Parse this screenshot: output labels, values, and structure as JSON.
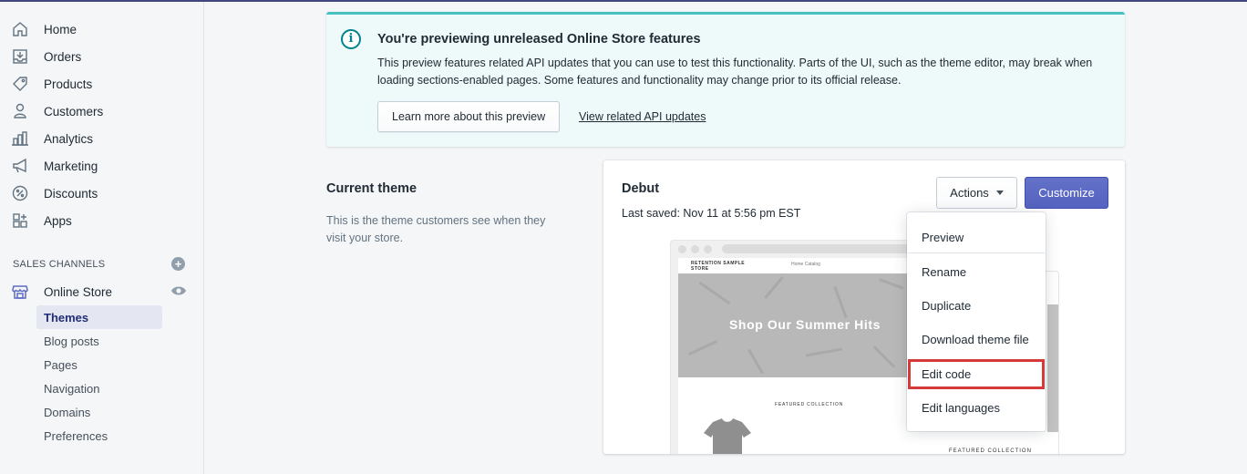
{
  "sidebar": {
    "items": [
      {
        "label": "Home",
        "icon": "home-icon"
      },
      {
        "label": "Orders",
        "icon": "orders-icon"
      },
      {
        "label": "Products",
        "icon": "tag-icon"
      },
      {
        "label": "Customers",
        "icon": "person-icon"
      },
      {
        "label": "Analytics",
        "icon": "bar-chart-icon"
      },
      {
        "label": "Marketing",
        "icon": "megaphone-icon"
      },
      {
        "label": "Discounts",
        "icon": "discount-icon"
      },
      {
        "label": "Apps",
        "icon": "apps-icon"
      }
    ],
    "sales_channels_title": "SALES CHANNELS",
    "online_store_label": "Online Store",
    "sub_items": [
      "Themes",
      "Blog posts",
      "Pages",
      "Navigation",
      "Domains",
      "Preferences"
    ],
    "active_sub_item": "Themes"
  },
  "banner": {
    "title": "You're previewing unreleased Online Store features",
    "body": "This preview features related API updates that you can use to test this functionality. Parts of the UI, such as the theme editor, may break when loading sections-enabled pages. Some features and functionality may change prior to its official release.",
    "button_label": "Learn more about this preview",
    "link_label": "View related API updates",
    "accent_color": "#47c1bf"
  },
  "current_theme": {
    "heading": "Current theme",
    "description": "This is the theme customers see when they visit your store.",
    "theme_name": "Debut",
    "last_saved": "Last saved: Nov 11 at 5:56 pm EST",
    "actions_label": "Actions",
    "customize_label": "Customize",
    "customize_color": "#5c6ac4"
  },
  "preview": {
    "store_name": "RETENTION SAMPLE STORE",
    "nav_links": "Home   Catalog",
    "hero_text": "Shop Our Summer Hits",
    "featured_label": "FEATURED COLLECTION"
  },
  "actions_menu": {
    "items": [
      "Preview",
      "Rename",
      "Duplicate",
      "Download theme file",
      "Edit code",
      "Edit languages"
    ],
    "highlighted": "Edit code"
  }
}
